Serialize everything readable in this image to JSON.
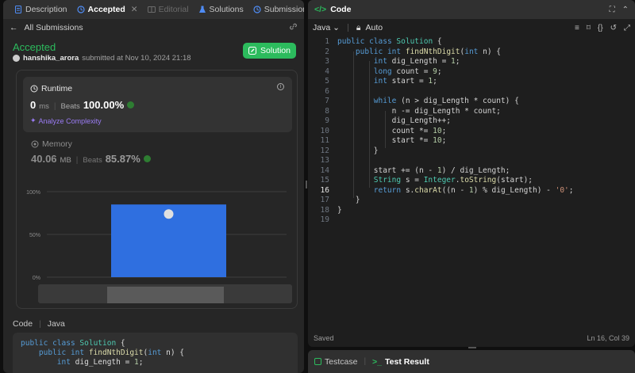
{
  "left_tabs": {
    "description": "Description",
    "accepted": "Accepted",
    "editorial": "Editorial",
    "solutions": "Solutions",
    "submissions": "Submissions"
  },
  "subbar": {
    "back_label": "All Submissions"
  },
  "submission": {
    "status": "Accepted",
    "user": "hanshika_arora",
    "submitted_text": "submitted at Nov 10, 2024 21:18",
    "solution_button": "Solution"
  },
  "runtime": {
    "label": "Runtime",
    "value": "0",
    "unit": "ms",
    "beats_label": "Beats",
    "beats_value": "100.00%",
    "analyze": "Analyze Complexity"
  },
  "memory": {
    "label": "Memory",
    "value": "40.06",
    "unit": "MB",
    "beats_label": "Beats",
    "beats_value": "85.87%"
  },
  "chart_data": {
    "type": "bar",
    "y_ticks": [
      "100%",
      "50%",
      "0%"
    ],
    "ylim": [
      0,
      100
    ],
    "values": [
      85
    ],
    "highlight_color": "#2f6fe0"
  },
  "code_section": {
    "label": "Code",
    "lang": "Java"
  },
  "code_preview": [
    "public class Solution {",
    "    public int findNthDigit(int n) {",
    "        int dig_Length = 1;"
  ],
  "editor_header": {
    "title": "Code"
  },
  "editor_toolbar": {
    "language": "Java",
    "mode": "Auto"
  },
  "editor": {
    "current_line": 16,
    "lines": [
      "public class Solution {",
      "    public int findNthDigit(int n) {",
      "        int dig_Length = 1;",
      "        long count = 9;",
      "        int start = 1;",
      "",
      "        while (n > dig_Length * count) {",
      "            n -= dig_Length * count;",
      "            dig_Length++;",
      "            count *= 10;",
      "            start *= 10;",
      "        }",
      "",
      "        start += (n - 1) / dig_Length;",
      "        String s = Integer.toString(start);",
      "        return s.charAt((n - 1) % dig_Length) - '0';",
      "    }",
      "}",
      ""
    ]
  },
  "status_bar": {
    "saved": "Saved",
    "position": "Ln 16, Col 39"
  },
  "bottom_tabs": {
    "testcase": "Testcase",
    "test_result": "Test Result"
  },
  "colors": {
    "accent_green": "#2cbb5d",
    "bar_blue": "#2f6fe0",
    "analyze_purple": "#9b7cf5"
  }
}
